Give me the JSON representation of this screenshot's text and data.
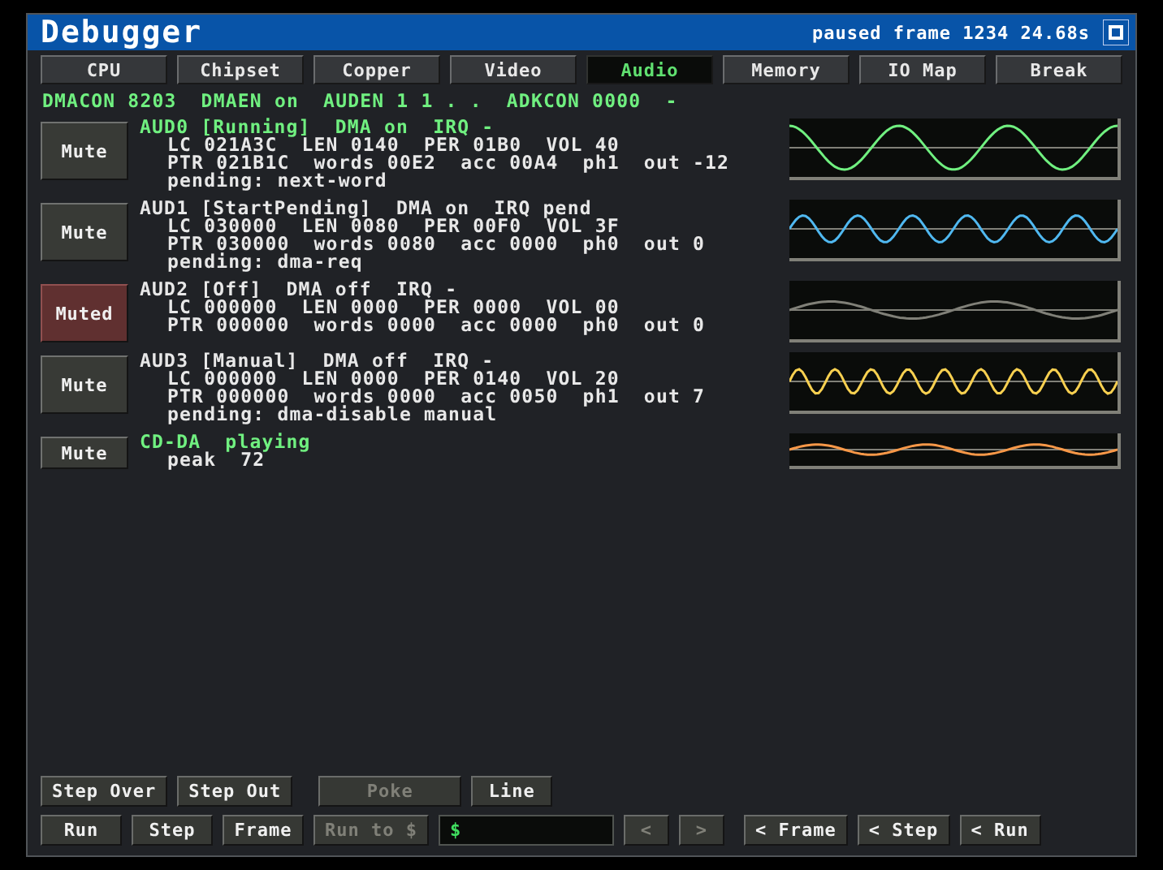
{
  "window": {
    "title": "Debugger",
    "status": "paused frame 1234 24.68s"
  },
  "tabs": [
    {
      "label": "CPU",
      "selected": false
    },
    {
      "label": "Chipset",
      "selected": false
    },
    {
      "label": "Copper",
      "selected": false
    },
    {
      "label": "Video",
      "selected": false
    },
    {
      "label": "Audio",
      "selected": true
    },
    {
      "label": "Memory",
      "selected": false
    },
    {
      "label": "IO Map",
      "selected": false
    },
    {
      "label": "Break",
      "selected": false
    }
  ],
  "summary": "DMACON 8203  DMAEN on  AUDEN 1 1 . .  ADKCON 0000  -",
  "channels": [
    {
      "kind": "aud",
      "header": "AUD0 [Running]  DMA on  IRQ -",
      "active": true,
      "mute": "Mute",
      "muted": false,
      "color": "#70f080",
      "lines": [
        "LC 021A3C  LEN 0140  PER 01B0  VOL 40",
        "PTR 021B1C  words 00E2  acc 00A4  ph1  out -12",
        "pending: next-word"
      ]
    },
    {
      "kind": "aud",
      "header": "AUD1 [StartPending]  DMA on  IRQ pend",
      "active": false,
      "mute": "Mute",
      "muted": false,
      "color": "#50b8f0",
      "lines": [
        "LC 030000  LEN 0080  PER 00F0  VOL 3F",
        "PTR 030000  words 0080  acc 0000  ph0  out 0",
        "pending: dma-req"
      ]
    },
    {
      "kind": "aud",
      "header": "AUD2 [Off]  DMA off  IRQ -",
      "active": false,
      "mute": "Muted",
      "muted": true,
      "color": "#808078",
      "lines": [
        "LC 000000  LEN 0000  PER 0000  VOL 00",
        "PTR 000000  words 0000  acc 0000  ph0  out 0"
      ]
    },
    {
      "kind": "aud",
      "header": "AUD3 [Manual]  DMA off  IRQ -",
      "active": false,
      "mute": "Mute",
      "muted": false,
      "color": "#f8d050",
      "lines": [
        "LC 000000  LEN 0000  PER 0140  VOL 20",
        "PTR 000000  words 0000  acc 0050  ph1  out 7",
        "pending: dma-disable manual"
      ]
    },
    {
      "kind": "cdda",
      "header": "CD-DA  playing",
      "active": true,
      "mute": "Mute",
      "muted": false,
      "color": "#f89848",
      "lines": [
        "peak  72"
      ]
    }
  ],
  "toolbar_rows": [
    [
      {
        "label": "Step Over",
        "disabled": false
      },
      {
        "label": "Step Out",
        "disabled": false
      },
      {
        "kind": "gap"
      },
      {
        "label": "Poke",
        "disabled": true
      },
      {
        "label": "Line",
        "disabled": false
      }
    ],
    [
      {
        "label": "Run",
        "disabled": false
      },
      {
        "label": "Step",
        "disabled": false
      },
      {
        "label": "Frame",
        "disabled": false
      },
      {
        "label": "Run to $",
        "disabled": true
      },
      {
        "kind": "input",
        "value": "$"
      },
      {
        "label": "<",
        "disabled": true
      },
      {
        "label": ">",
        "disabled": true
      },
      {
        "kind": "gap"
      },
      {
        "label": "< Frame",
        "disabled": false
      },
      {
        "label": "< Step",
        "disabled": false
      },
      {
        "label": "< Run",
        "disabled": false
      }
    ]
  ]
}
